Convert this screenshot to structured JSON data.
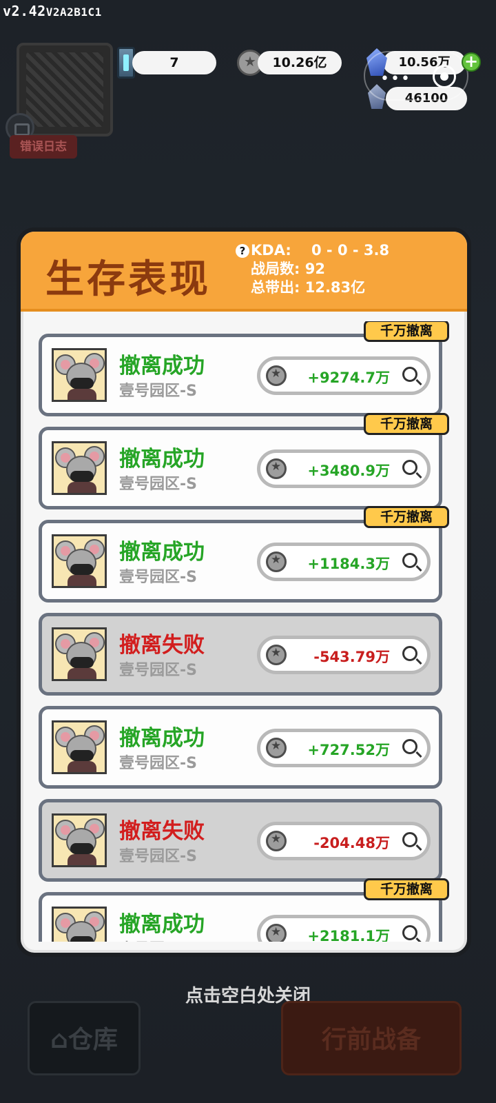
{
  "version": {
    "main": "v2.42",
    "build": "V2A2B1C1"
  },
  "top_bar": {
    "energy": "7",
    "coins": "10.26亿",
    "gems": "10.56万",
    "gems_secondary": "46100",
    "error_log": "错误日志"
  },
  "panel": {
    "title": "生存表现",
    "kda_label": "KDA:",
    "kda_value": "0 - 0 - 3.8",
    "matches_label": "战局数:",
    "matches_value": "92",
    "total_label": "总带出:",
    "total_value": "12.83亿"
  },
  "tag_label": "千万撤离",
  "records": [
    {
      "status": "撤离成功",
      "zone": "壹号园区-S",
      "amount": "+9274.7万",
      "success": true,
      "tag": true
    },
    {
      "status": "撤离成功",
      "zone": "壹号园区-S",
      "amount": "+3480.9万",
      "success": true,
      "tag": true
    },
    {
      "status": "撤离成功",
      "zone": "壹号园区-S",
      "amount": "+1184.3万",
      "success": true,
      "tag": true
    },
    {
      "status": "撤离失败",
      "zone": "壹号园区-S",
      "amount": "-543.79万",
      "success": false,
      "tag": false
    },
    {
      "status": "撤离成功",
      "zone": "壹号园区-S",
      "amount": "+727.52万",
      "success": true,
      "tag": false
    },
    {
      "status": "撤离失败",
      "zone": "壹号园区-S",
      "amount": "-204.48万",
      "success": false,
      "tag": false
    },
    {
      "status": "撤离成功",
      "zone": "壹号园区-S",
      "amount": "+2181.1万",
      "success": true,
      "tag": true
    }
  ],
  "bottom": {
    "hint": "点击空白处关闭",
    "warehouse": "仓库",
    "prepare": "行前战备"
  },
  "colors": {
    "header": "#f7a53b",
    "title": "#8b3a0f",
    "success": "#26a526",
    "fail": "#d21e1e",
    "tag": "#ffc94b"
  }
}
